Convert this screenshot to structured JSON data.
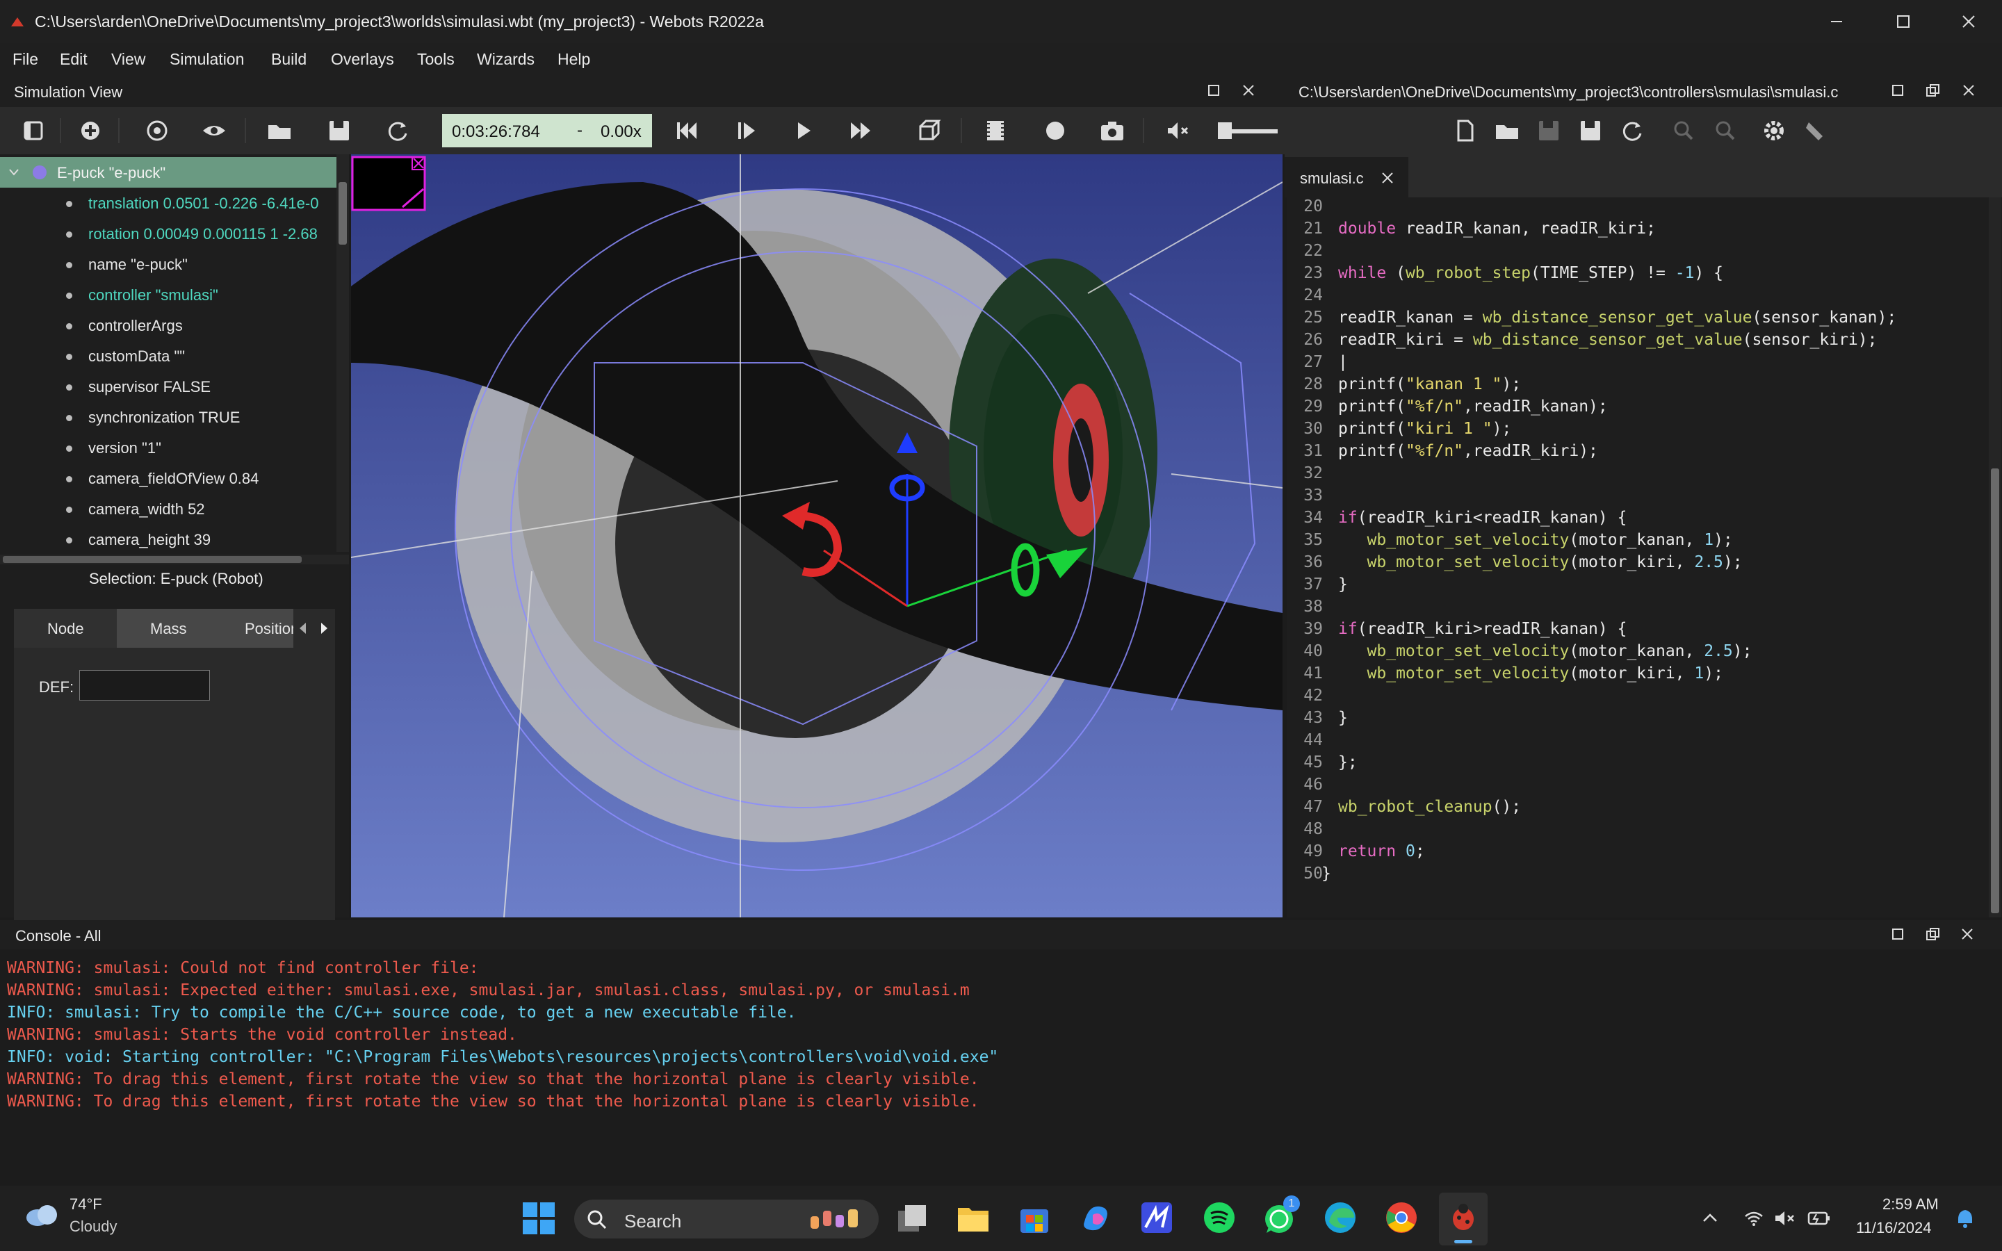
{
  "window": {
    "title": "C:\\Users\\arden\\OneDrive\\Documents\\my_project3\\worlds\\simulasi.wbt (my_project3) - Webots R2022a"
  },
  "menu": [
    "File",
    "Edit",
    "View",
    "Simulation",
    "Build",
    "Overlays",
    "Tools",
    "Wizards",
    "Help"
  ],
  "simulation_view": {
    "title": "Simulation View",
    "time": "0:03:26:784",
    "speed_sep": "-",
    "speed": "0.00x"
  },
  "scene_tree": {
    "root": "E-puck \"e-puck\"",
    "fields": [
      {
        "text": "translation 0.0501 -0.226 -6.41e-0",
        "highlight": true
      },
      {
        "text": "rotation 0.00049 0.000115 1 -2.68",
        "highlight": true
      },
      {
        "text": "name \"e-puck\"",
        "highlight": false
      },
      {
        "text": "controller \"smulasi\"",
        "highlight": true
      },
      {
        "text": "controllerArgs",
        "highlight": false
      },
      {
        "text": "customData \"\"",
        "highlight": false
      },
      {
        "text": "supervisor FALSE",
        "highlight": false
      },
      {
        "text": "synchronization TRUE",
        "highlight": false
      },
      {
        "text": "version \"1\"",
        "highlight": false
      },
      {
        "text": "camera_fieldOfView 0.84",
        "highlight": false
      },
      {
        "text": "camera_width 52",
        "highlight": false
      },
      {
        "text": "camera_height 39",
        "highlight": false
      }
    ]
  },
  "selection": {
    "label": "Selection: E-puck (Robot)",
    "tabs": [
      "Node",
      "Mass",
      "Position"
    ],
    "def_label": "DEF:",
    "def_value": ""
  },
  "editor": {
    "path": "C:\\Users\\arden\\OneDrive\\Documents\\my_project3\\controllers\\smulasi\\smulasi.c",
    "tab": "smulasi.c"
  },
  "console": {
    "title": "Console - All",
    "lines": [
      {
        "type": "warn",
        "text": "WARNING: smulasi: Could not find controller file:"
      },
      {
        "type": "warn",
        "text": "WARNING: smulasi: Expected either: smulasi.exe, smulasi.jar, smulasi.class, smulasi.py, or smulasi.m"
      },
      {
        "type": "info",
        "text": "INFO: smulasi: Try to compile the C/C++ source code, to get a new executable file."
      },
      {
        "type": "warn",
        "text": "WARNING: smulasi: Starts the void controller instead."
      },
      {
        "type": "info",
        "text": "INFO: void: Starting controller: \"C:\\Program Files\\Webots\\resources\\projects\\controllers\\void\\void.exe\""
      },
      {
        "type": "warn",
        "text": "WARNING: To drag this element, first rotate the view so that the horizontal plane is clearly visible."
      },
      {
        "type": "warn",
        "text": "WARNING: To drag this element, first rotate the view so that the horizontal plane is clearly visible."
      }
    ]
  },
  "taskbar": {
    "weather_temp": "74°F",
    "weather_desc": "Cloudy",
    "search_placeholder": "Search",
    "whatsapp_badge": "1",
    "time": "2:59 AM",
    "date": "11/16/2024"
  },
  "colors": {
    "accent_teal": "#4fd8c0",
    "warning": "#ee5a4d",
    "info": "#66d0ef",
    "sky": "#3c4a93"
  }
}
